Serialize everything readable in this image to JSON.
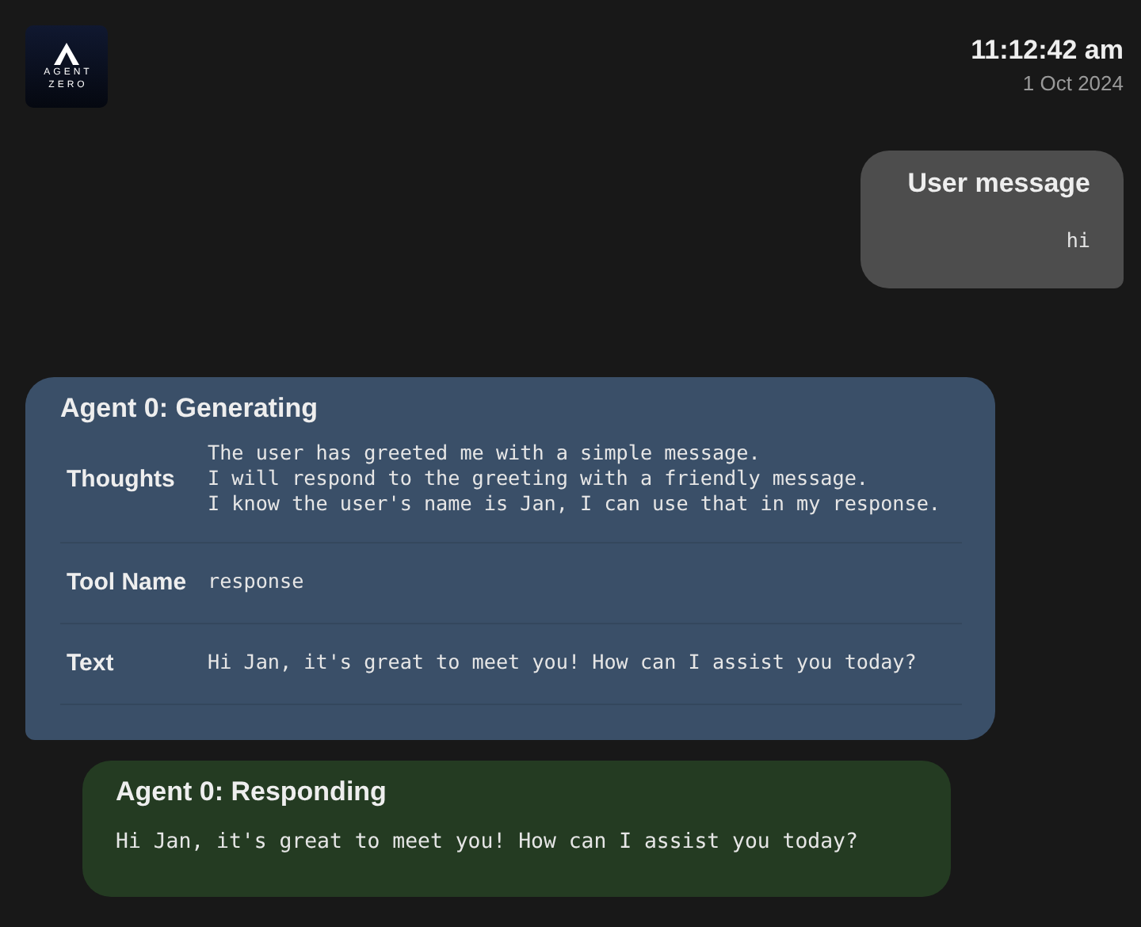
{
  "logo": {
    "line_1": "AGENT",
    "line_2": "ZERO"
  },
  "timestamp": {
    "time": "11:12:42 am",
    "date": "1 Oct 2024"
  },
  "messages": [
    {
      "kind": "user",
      "heading": "User message",
      "body": "hi"
    },
    {
      "kind": "agent",
      "heading": "Agent 0: Generating",
      "rows": [
        {
          "label": "Thoughts",
          "value": [
            "The user has greeted me with a simple message.",
            "I will respond to the greeting with a friendly message.",
            "I know the user's name is Jan, I can use that in my response."
          ]
        },
        {
          "label": "Tool Name",
          "value": [
            "response"
          ]
        },
        {
          "label": "Text",
          "value": [
            "Hi Jan, it's great to meet you! How can I assist you today?"
          ]
        }
      ]
    },
    {
      "kind": "response",
      "heading": "Agent 0: Responding",
      "body": "Hi Jan, it's great to meet you! How can I assist you today?"
    }
  ]
}
